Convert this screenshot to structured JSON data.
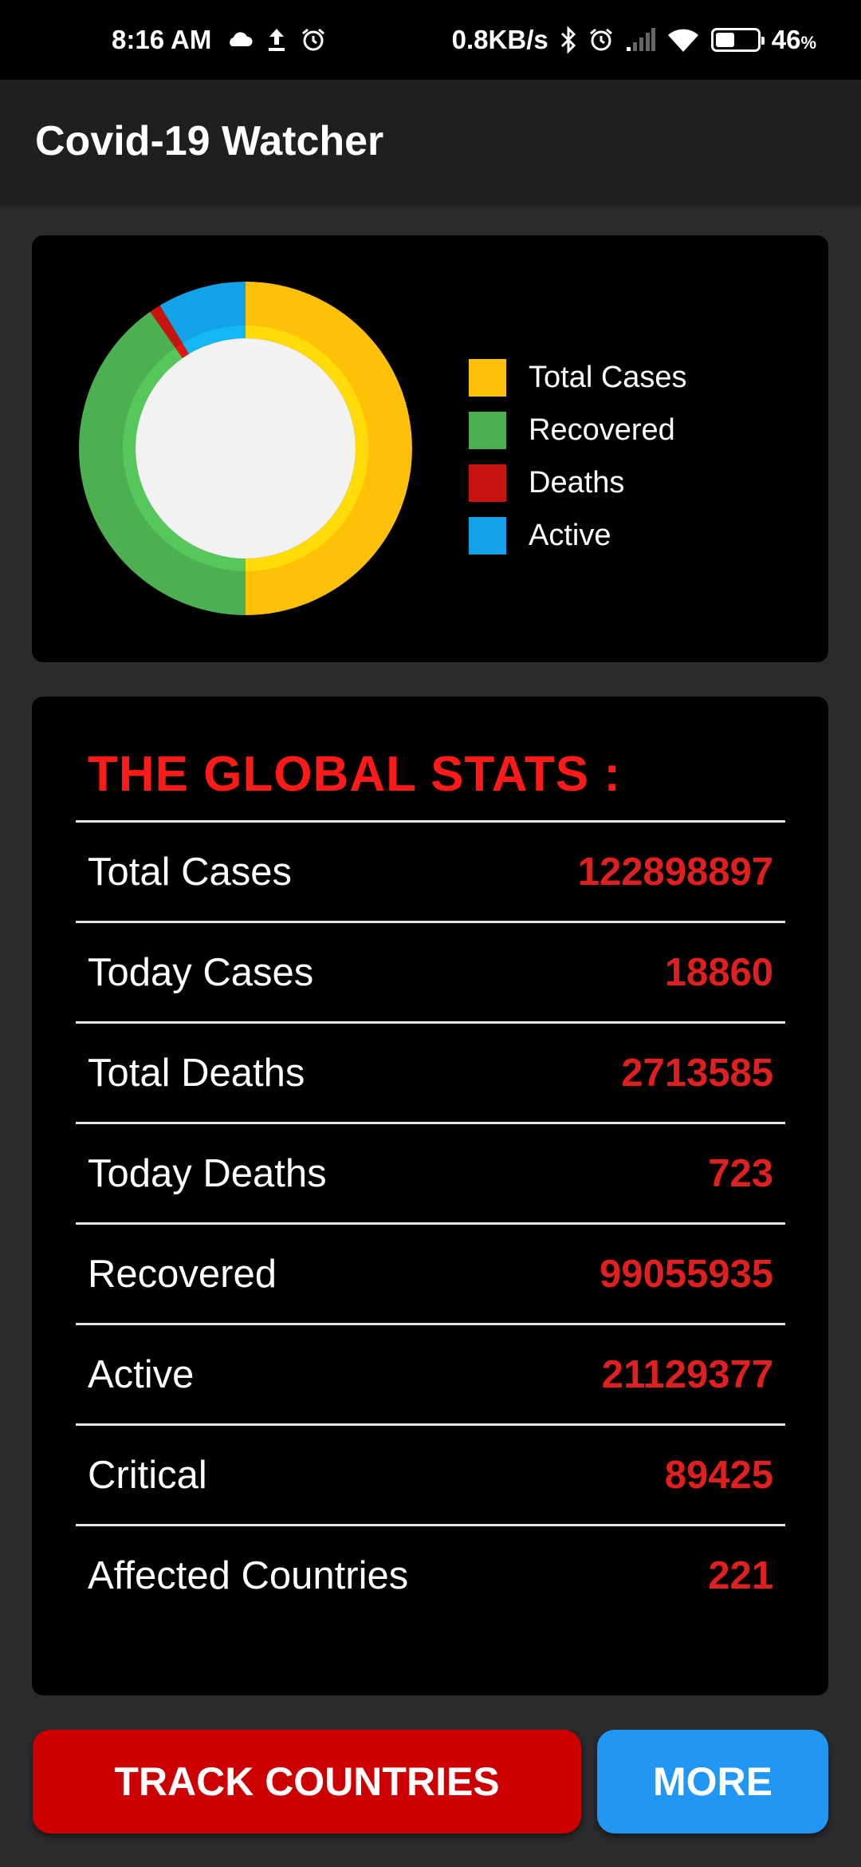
{
  "status_bar": {
    "time": "8:16 AM",
    "network_speed": "0.8KB/s",
    "battery_percent": "46",
    "battery_level": 0.46,
    "icons": [
      "cloud-icon",
      "upload-icon",
      "alarm-icon",
      "bluetooth-icon",
      "alarm-icon",
      "signal-icon",
      "wifi-icon",
      "battery-icon"
    ]
  },
  "app_bar": {
    "title": "Covid-19 Watcher"
  },
  "chart_data": {
    "type": "pie",
    "categories": [
      "Total Cases",
      "Recovered",
      "Deaths",
      "Active"
    ],
    "values": [
      122898897,
      99055935,
      2713585,
      21129377
    ],
    "colors": [
      "#ffc107",
      "#4caf50",
      "#c8130e",
      "#12a2e8"
    ],
    "legend_position": "right"
  },
  "stats": {
    "title": "THE GLOBAL STATS :",
    "rows": [
      {
        "label": "Total Cases",
        "value": "122898897"
      },
      {
        "label": "Today Cases",
        "value": "18860"
      },
      {
        "label": "Total Deaths",
        "value": "2713585"
      },
      {
        "label": "Today Deaths",
        "value": "723"
      },
      {
        "label": "Recovered",
        "value": "99055935"
      },
      {
        "label": "Active",
        "value": "21129377"
      },
      {
        "label": "Critical",
        "value": "89425"
      },
      {
        "label": "Affected Countries",
        "value": "221"
      }
    ]
  },
  "buttons": {
    "track_countries": "TRACK COUNTRIES",
    "more": "MORE"
  },
  "colors": {
    "background": "#2b2b2d",
    "card": "#000000",
    "accent_red": "#e02020",
    "button_red": "#cc0000",
    "button_blue": "#2196f3"
  }
}
